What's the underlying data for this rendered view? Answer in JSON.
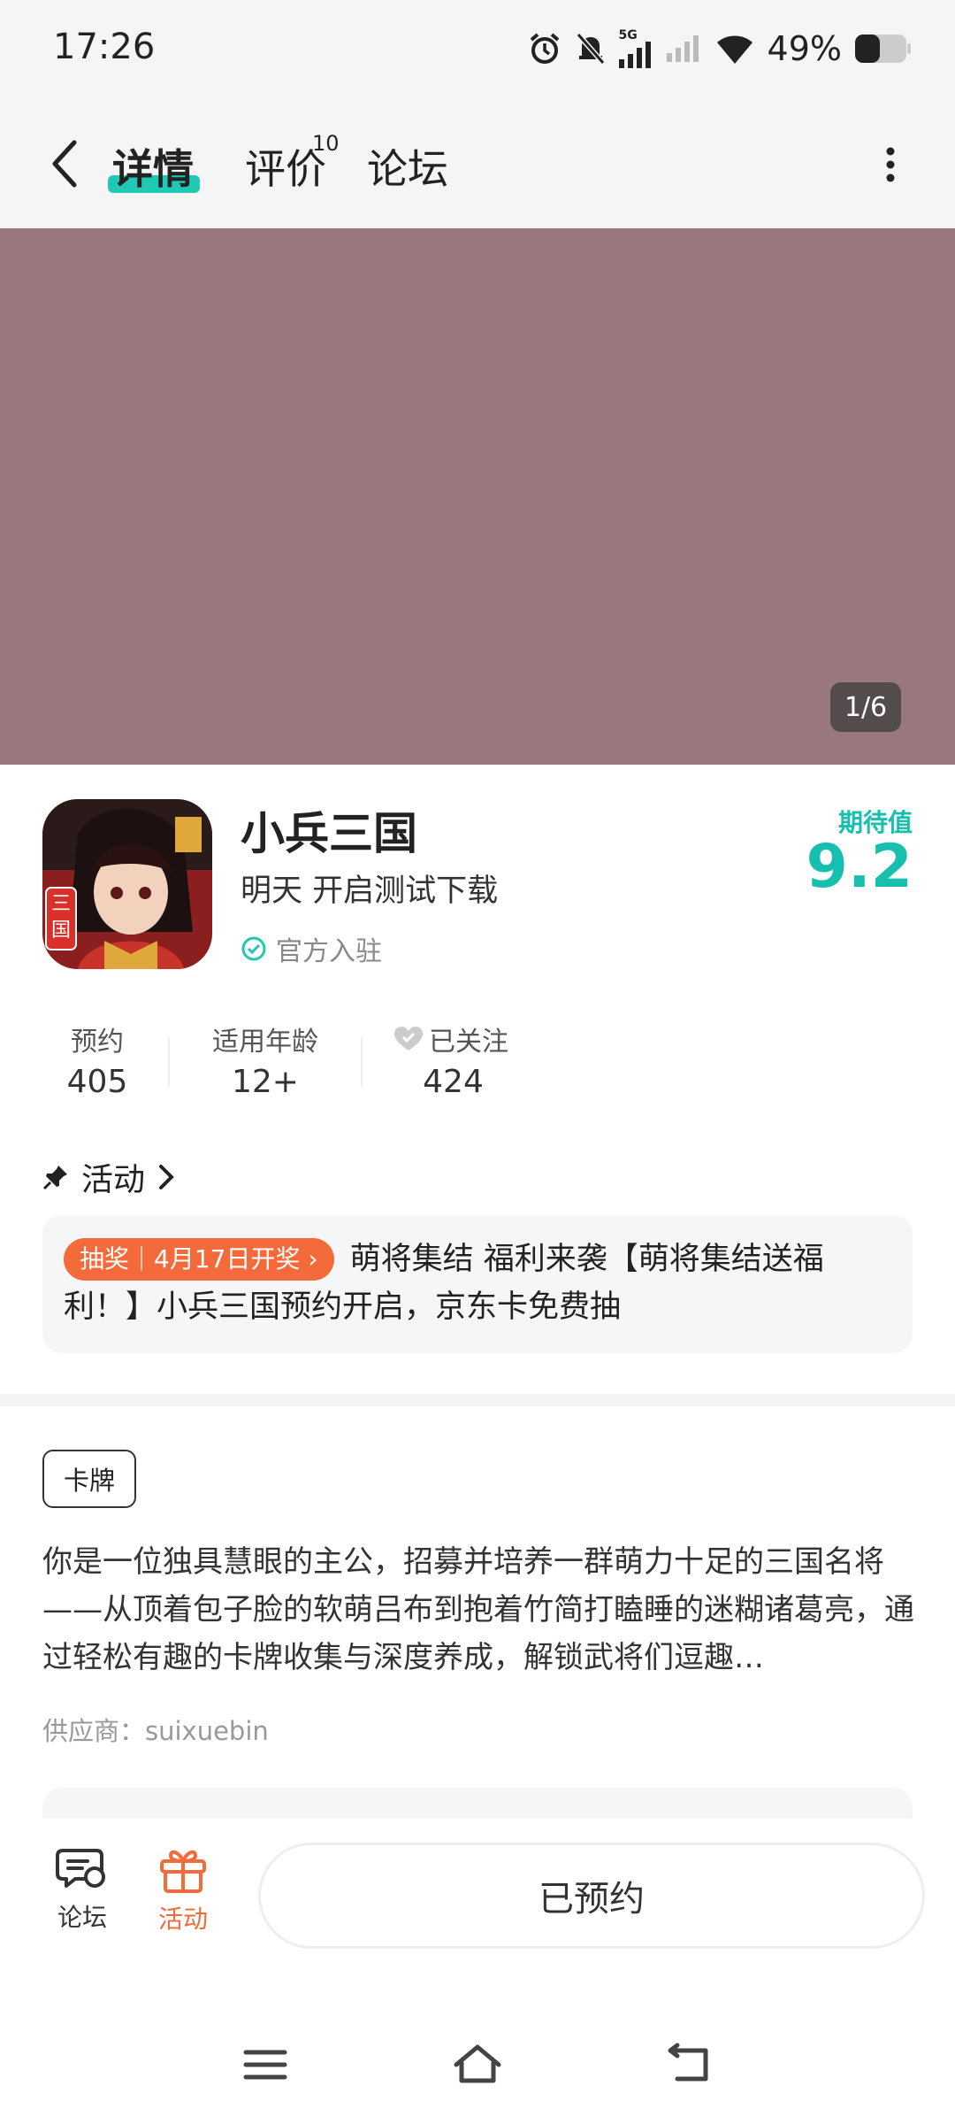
{
  "status_bar": {
    "time": "17:26",
    "network": "5G",
    "battery": "49%"
  },
  "header": {
    "tabs": [
      {
        "label": "详情",
        "active": true
      },
      {
        "label": "评价",
        "badge": "10"
      },
      {
        "label": "论坛"
      }
    ]
  },
  "banner": {
    "pager": "1/6",
    "color": "#98787d"
  },
  "app": {
    "name": "小兵三国",
    "subtitle": "明天 开启测试下载",
    "official": "官方入驻",
    "icon_text": "三国",
    "expect_label": "期待值",
    "expect_value": "9.2"
  },
  "stats": [
    {
      "label": "预约",
      "value": "405"
    },
    {
      "label": "适用年龄",
      "value": "12+"
    },
    {
      "label": "已关注",
      "value": "424"
    }
  ],
  "activity": {
    "title": "活动",
    "tag": "抽奖｜4月17日开奖",
    "text": "萌将集结 福利来袭【萌将集结送福利！】小兵三国预约开启，京东卡免费抽"
  },
  "details": {
    "genre": "卡牌",
    "description": "你是一位独具慧眼的主公，招募并培养一群萌力十足的三国名将——从顶着包子脸的软萌吕布到抱着竹简打瞌睡的迷糊诸葛亮，通过轻松有趣的卡牌收集与深度养成，解锁武将们逗趣…",
    "supplier": "供应商：suixuebin"
  },
  "bottom_bar": {
    "forum": "论坛",
    "activity": "活动",
    "reserve": "已预约"
  },
  "colors": {
    "accent": "#21c8b3",
    "activity_orange": "#f46a3a"
  }
}
